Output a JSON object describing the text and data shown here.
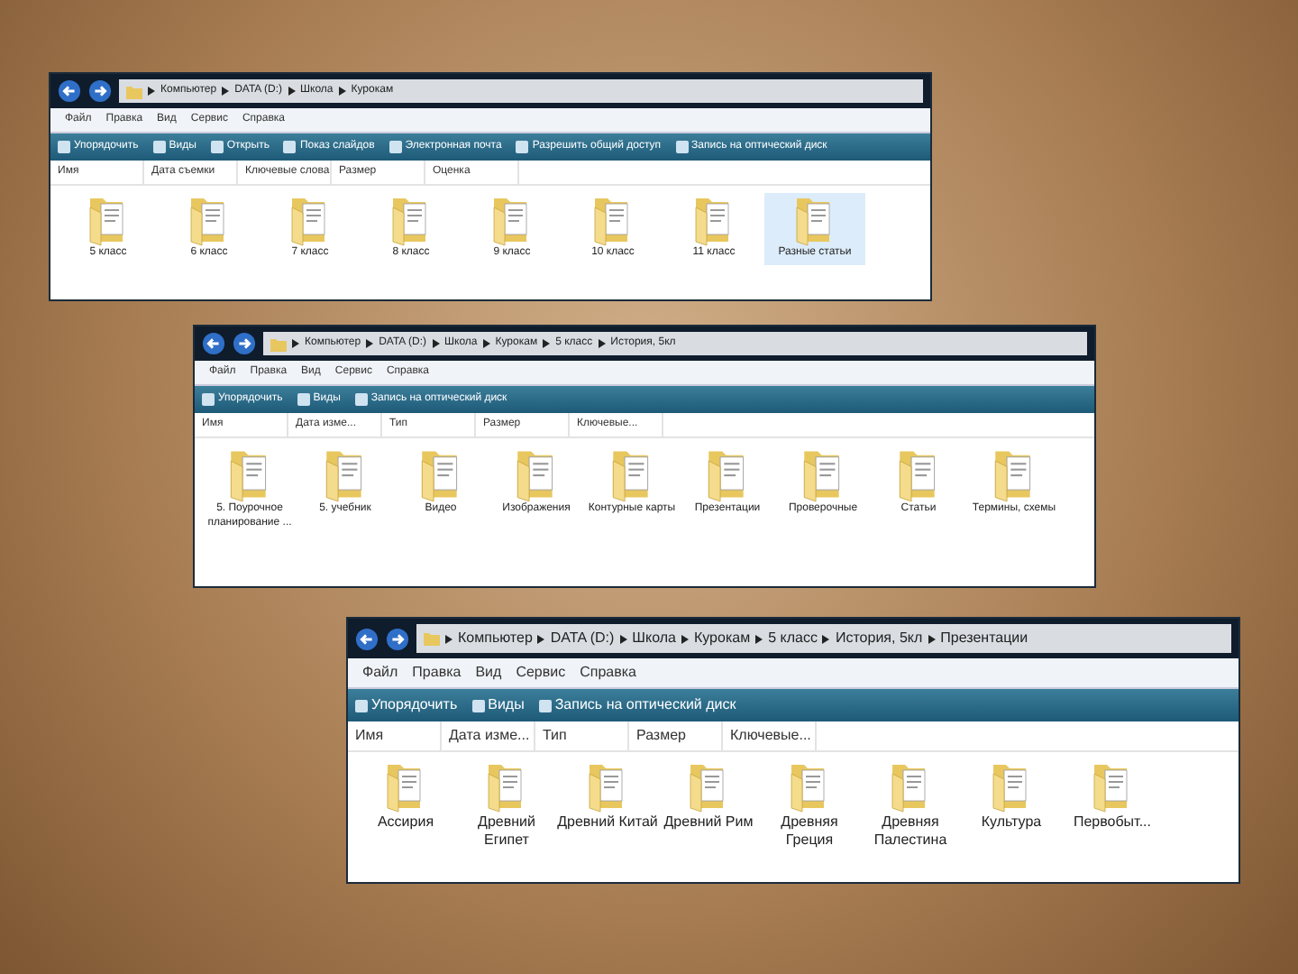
{
  "windows": [
    {
      "address": [
        "Компьютер",
        "DATA (D:)",
        "Школа",
        "Курокам"
      ],
      "menu": [
        "Файл",
        "Правка",
        "Вид",
        "Сервис",
        "Справка"
      ],
      "toolbar": [
        "Упорядочить",
        "Виды",
        "Открыть",
        "Показ слайдов",
        "Электронная почта",
        "Разрешить общий доступ",
        "Запись на оптический диск"
      ],
      "columns": [
        "Имя",
        "Дата съемки",
        "Ключевые слова",
        "Размер",
        "Оценка"
      ],
      "folders": [
        {
          "name": "5 класс",
          "selected": false
        },
        {
          "name": "6 класс",
          "selected": false
        },
        {
          "name": "7 класс",
          "selected": false
        },
        {
          "name": "8 класс",
          "selected": false
        },
        {
          "name": "9 класс",
          "selected": false
        },
        {
          "name": "10 класс",
          "selected": false
        },
        {
          "name": "11 класс",
          "selected": false
        },
        {
          "name": "Разные статьи",
          "selected": true
        }
      ]
    },
    {
      "address": [
        "Компьютер",
        "DATA (D:)",
        "Школа",
        "Курокам",
        "5 класс",
        "История, 5кл"
      ],
      "menu": [
        "Файл",
        "Правка",
        "Вид",
        "Сервис",
        "Справка"
      ],
      "toolbar": [
        "Упорядочить",
        "Виды",
        "Запись на оптический диск"
      ],
      "columns": [
        "Имя",
        "Дата изме...",
        "Тип",
        "Размер",
        "Ключевые..."
      ],
      "folders": [
        {
          "name": "5. Поурочное планирование ...",
          "selected": false
        },
        {
          "name": "5. учебник",
          "selected": false
        },
        {
          "name": "Видео",
          "selected": false
        },
        {
          "name": "Изображения",
          "selected": false
        },
        {
          "name": "Контурные карты",
          "selected": false
        },
        {
          "name": "Презентации",
          "selected": false
        },
        {
          "name": "Проверочные",
          "selected": false
        },
        {
          "name": "Статьи",
          "selected": false
        },
        {
          "name": "Термины, схемы",
          "selected": false
        }
      ]
    },
    {
      "address": [
        "Компьютер",
        "DATA (D:)",
        "Школа",
        "Курокам",
        "5 класс",
        "История, 5кл",
        "Презентации"
      ],
      "menu": [
        "Файл",
        "Правка",
        "Вид",
        "Сервис",
        "Справка"
      ],
      "toolbar": [
        "Упорядочить",
        "Виды",
        "Запись на оптический диск"
      ],
      "columns": [
        "Имя",
        "Дата изме...",
        "Тип",
        "Размер",
        "Ключевые..."
      ],
      "folders": [
        {
          "name": "Ассирия",
          "selected": false
        },
        {
          "name": "Древний Египет",
          "selected": false
        },
        {
          "name": "Древний Китай",
          "selected": false
        },
        {
          "name": "Древний Рим",
          "selected": false
        },
        {
          "name": "Древняя Греция",
          "selected": false
        },
        {
          "name": "Древняя Палестина",
          "selected": false
        },
        {
          "name": "Культура",
          "selected": false
        },
        {
          "name": "Первобыт...",
          "selected": false
        }
      ]
    }
  ]
}
